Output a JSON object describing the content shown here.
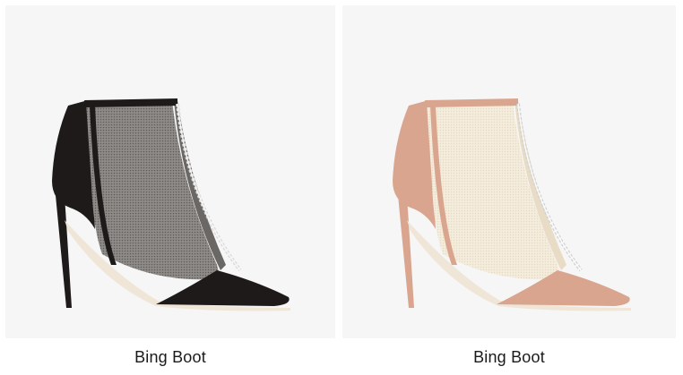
{
  "products": [
    {
      "name": "Bing Boot",
      "colorway": "black",
      "colors": {
        "suede": "#1d1a19",
        "mesh": "#3a3837",
        "lining": "#efe6d8"
      }
    },
    {
      "name": "Bing Boot",
      "colorway": "ballet pink",
      "colors": {
        "suede": "#d9a58e",
        "mesh": "#f3ead9",
        "lining": "#efe6d8"
      }
    }
  ]
}
